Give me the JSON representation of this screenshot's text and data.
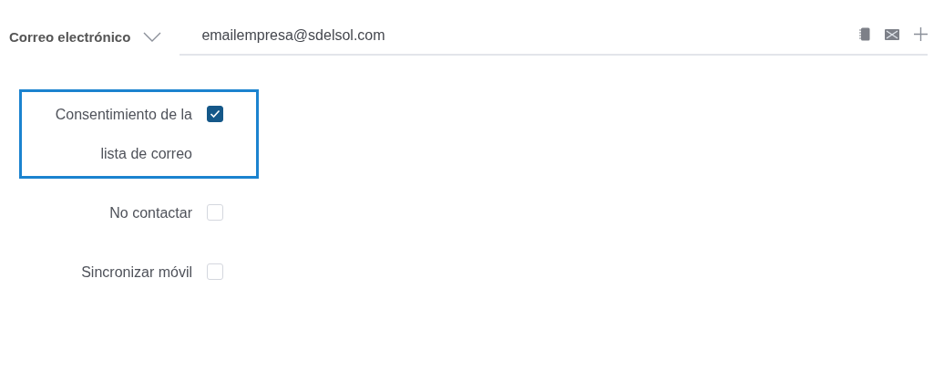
{
  "field": {
    "label": "Correo electrónico",
    "value": "emailempresa@sdelsol.com"
  },
  "options": [
    {
      "label": "Consentimiento de la lista de correo",
      "checked": true,
      "highlighted": true
    },
    {
      "label": "No contactar",
      "checked": false,
      "highlighted": false
    },
    {
      "label": "Sincronizar móvil",
      "checked": false,
      "highlighted": false
    }
  ]
}
